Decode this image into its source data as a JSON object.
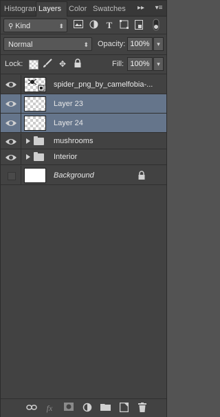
{
  "tabs": [
    {
      "label": "Histogram",
      "active": false
    },
    {
      "label": "Layers",
      "active": true
    },
    {
      "label": "Color",
      "active": false
    },
    {
      "label": "Swatches",
      "active": false
    }
  ],
  "filter": {
    "kind_label": "Kind"
  },
  "blend": {
    "mode": "Normal",
    "opacity_label": "Opacity:",
    "opacity_value": "100%"
  },
  "lock": {
    "label": "Lock:",
    "fill_label": "Fill:",
    "fill_value": "100%"
  },
  "layers": [
    {
      "name": "spider_png_by_camelfobia-...",
      "type": "smart-object",
      "visible": true,
      "selected": false
    },
    {
      "name": "Layer 23",
      "type": "pixel",
      "visible": true,
      "selected": true
    },
    {
      "name": "Layer 24",
      "type": "pixel",
      "visible": true,
      "selected": true
    },
    {
      "name": "mushrooms",
      "type": "group",
      "visible": true,
      "selected": false
    },
    {
      "name": "Interior",
      "type": "group",
      "visible": true,
      "selected": false
    },
    {
      "name": "Background",
      "type": "background",
      "visible": false,
      "selected": false,
      "locked": true
    }
  ],
  "colors": {
    "panel_bg": "#424242",
    "selected_row": "#65758b",
    "tab_bar": "#383838"
  }
}
